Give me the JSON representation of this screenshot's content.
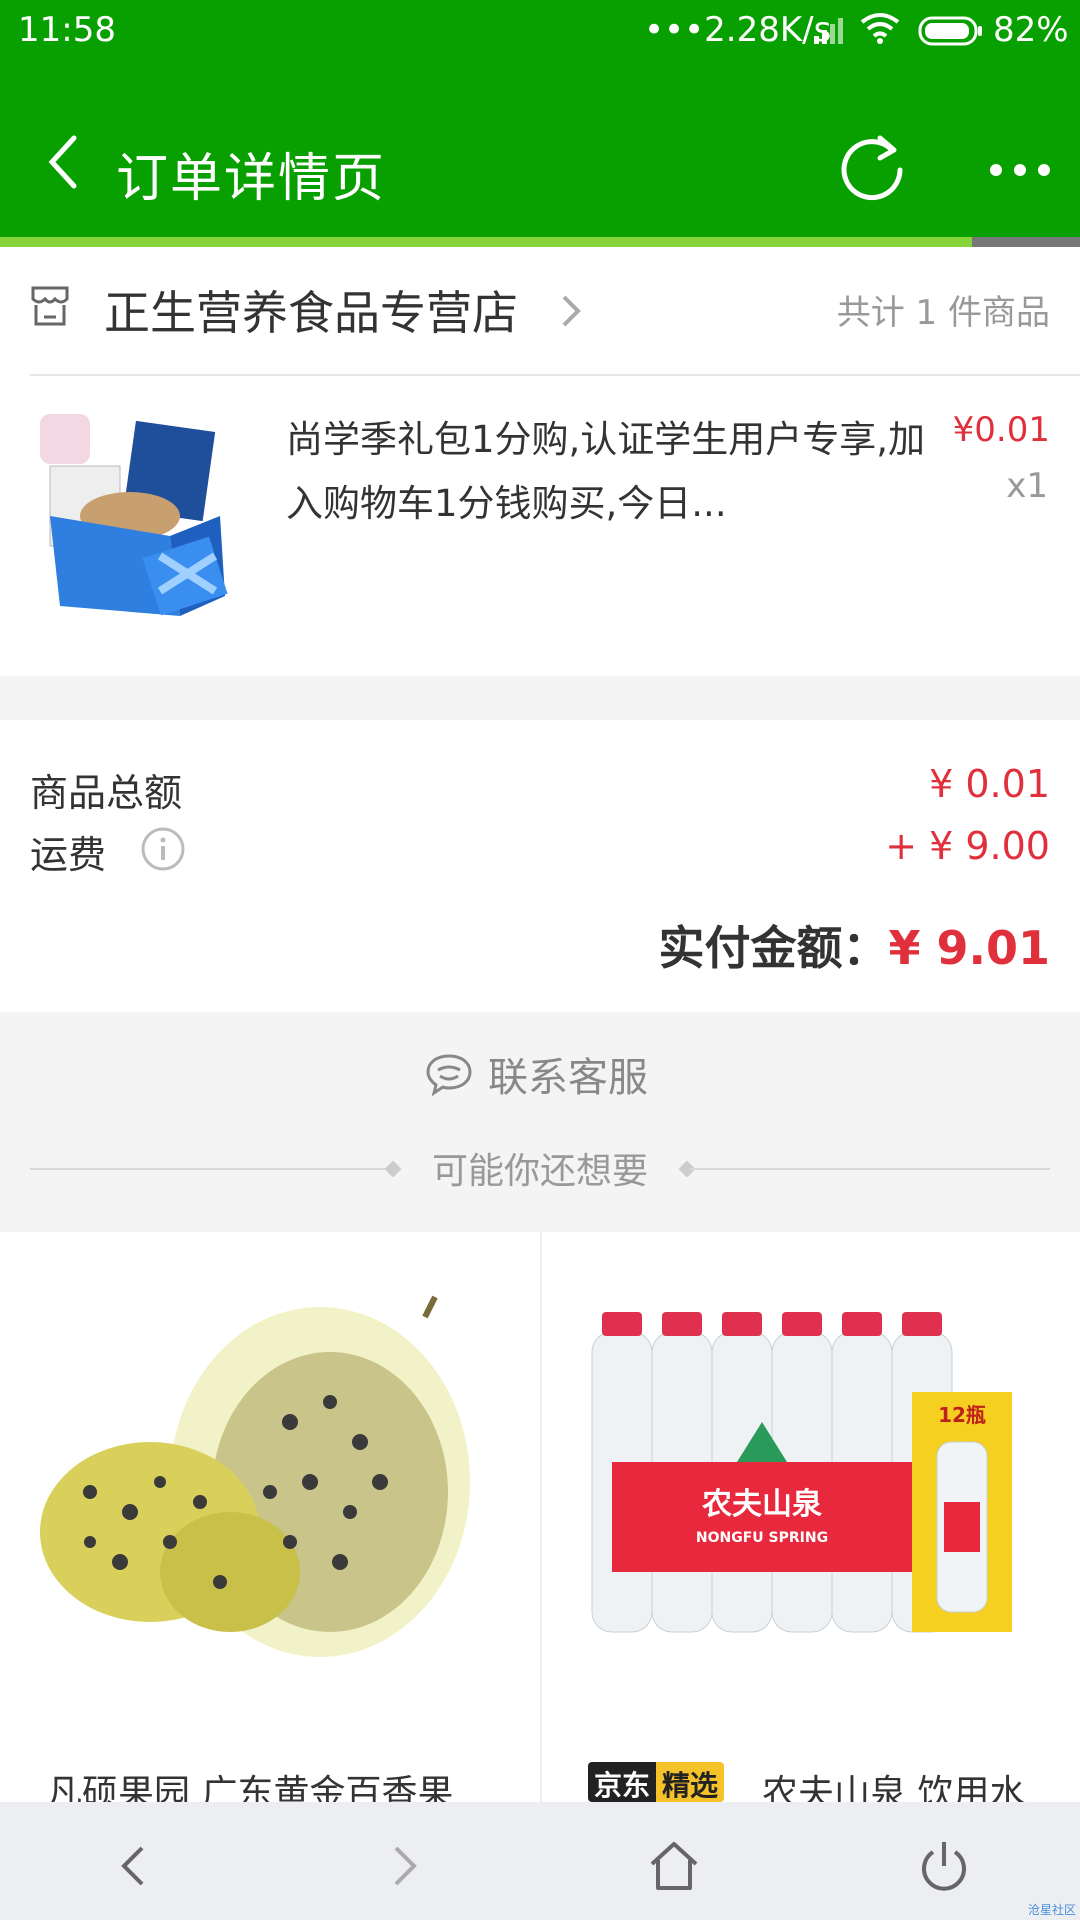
{
  "status_bar": {
    "time": "11:58",
    "network_speed": "•••2.28K/s",
    "battery": "82%"
  },
  "header": {
    "title": "订单详情页",
    "back_icon": "chevron-left-icon",
    "refresh_icon": "refresh-icon",
    "more_icon": "more-dots-icon"
  },
  "page_load_progress": 0.9,
  "shop": {
    "name": "正生营养食品专营店",
    "item_count": "共计 1 件商品"
  },
  "product": {
    "name": "尚学季礼包1分购,认证学生用户专享,加入购物车1分钱购买,今日...",
    "price": "¥0.01",
    "quantity": "x1"
  },
  "summary": {
    "goods_total_label": "商品总额",
    "goods_total_value": "¥ 0.01",
    "shipping_label": "运费",
    "shipping_value": "+ ¥ 9.00",
    "paid_label": "实付金额：",
    "paid_value": "¥ 9.01"
  },
  "service": {
    "contact_label": "联系客服",
    "recommend_title": "可能你还想要"
  },
  "recommendations": [
    {
      "name": "凡硕果园 广东黄金百香果"
    },
    {
      "badge_left": "京东",
      "badge_right": "精选",
      "name": "农夫山泉 饮用水"
    }
  ],
  "water_pack_text": {
    "brand": "农夫山泉",
    "brand_en": "NONGFU SPRING",
    "pack_count": "12瓶"
  },
  "watermark": "沧星社区",
  "colors": {
    "brand_green": "#08a000",
    "price_red": "#e0303c",
    "progress_green": "#86d43a"
  }
}
